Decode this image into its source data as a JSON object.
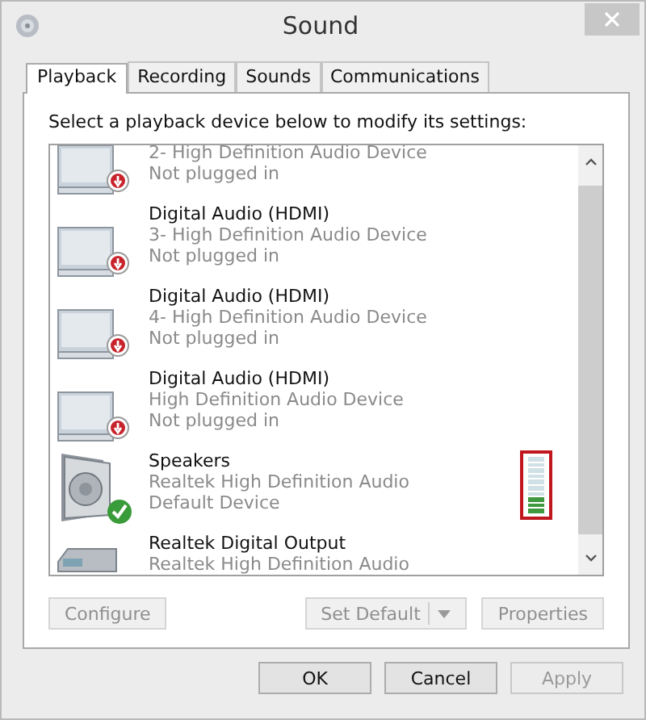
{
  "window": {
    "title": "Sound"
  },
  "tabs": [
    {
      "label": "Playback",
      "selected": true
    },
    {
      "label": "Recording",
      "selected": false
    },
    {
      "label": "Sounds",
      "selected": false
    },
    {
      "label": "Communications",
      "selected": false
    }
  ],
  "instruction": "Select a playback device below to modify its settings:",
  "devices": [
    {
      "kind": "monitor",
      "unplugged": true,
      "is_default": false,
      "description": "2- High Definition Audio Device",
      "state_text": "Not plugged in"
    },
    {
      "kind": "monitor",
      "unplugged": true,
      "is_default": false,
      "name": "Digital Audio (HDMI)",
      "description": "3- High Definition Audio Device",
      "state_text": "Not plugged in"
    },
    {
      "kind": "monitor",
      "unplugged": true,
      "is_default": false,
      "name": "Digital Audio (HDMI)",
      "description": "4- High Definition Audio Device",
      "state_text": "Not plugged in"
    },
    {
      "kind": "monitor",
      "unplugged": true,
      "is_default": false,
      "name": "Digital Audio (HDMI)",
      "description": "High Definition Audio Device",
      "state_text": "Not plugged in"
    },
    {
      "kind": "speaker",
      "unplugged": false,
      "is_default": true,
      "name": "Speakers",
      "description": "Realtek High Definition Audio",
      "state_text": "Default Device",
      "meter": {
        "level": 0.3,
        "highlighted": true
      }
    },
    {
      "kind": "receiver",
      "unplugged": false,
      "is_default": false,
      "name": "Realtek Digital Output",
      "description": "Realtek High Definition Audio"
    }
  ],
  "panel_buttons": [
    {
      "label": "Configure",
      "disabled": true,
      "dropdown": false
    },
    {
      "label": "Set Default",
      "disabled": true,
      "dropdown": true
    },
    {
      "label": "Properties",
      "disabled": true,
      "dropdown": false
    }
  ],
  "dialog_buttons": [
    {
      "label": "OK",
      "disabled": false
    },
    {
      "label": "Cancel",
      "disabled": false
    },
    {
      "label": "Apply",
      "disabled": true
    }
  ]
}
